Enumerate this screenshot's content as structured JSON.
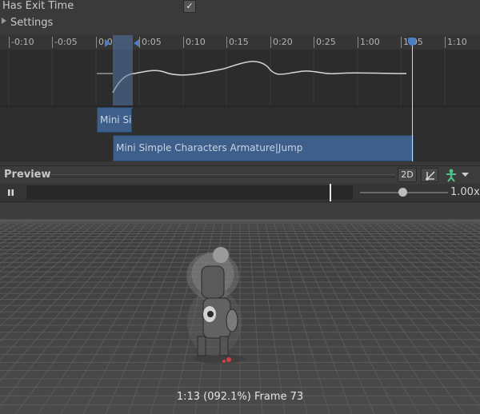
{
  "settings": {
    "has_exit_time_label": "Has Exit Time",
    "has_exit_time_checked": true,
    "check_glyph": "✓",
    "settings_label": "Settings"
  },
  "timeline": {
    "ruler_labels": [
      "-0:10",
      "-0:05",
      "0:0",
      "0:05",
      "0:10",
      "0:15",
      "0:20",
      "0:25",
      "1:00",
      "1:05",
      "1:10"
    ],
    "clips": {
      "source_clip_label": "Mini Si",
      "target_clip_label": "Mini Simple Characters Armature|Jump"
    },
    "colors": {
      "clip": "#3e5f8a",
      "marker": "#4a7fc4"
    }
  },
  "preview": {
    "title": "Preview",
    "mode_2d_label": "2D",
    "pivot_icon": "pivot-icon",
    "avatar_icon": "humanoid-avatar-icon",
    "dropdown_icon": "chevron-down-icon"
  },
  "playback": {
    "pause_icon": "pause-icon",
    "speed_label": "1.00x",
    "speed_fraction": 0.49
  },
  "viewport": {
    "frame_info": "1:13 (092.1%) Frame 73"
  }
}
